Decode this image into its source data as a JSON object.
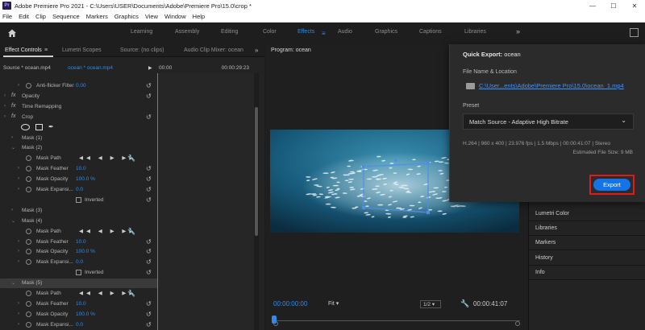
{
  "window": {
    "title": "Adobe Premiere Pro 2021 - C:\\Users\\USER\\Documents\\Adobe\\Premiere Pro\\15.0\\crop *",
    "app_badge": "Pr",
    "minimize": "—",
    "maximize": "☐",
    "close": "✕"
  },
  "menu": [
    "File",
    "Edit",
    "Clip",
    "Sequence",
    "Markers",
    "Graphics",
    "View",
    "Window",
    "Help"
  ],
  "workspaces": {
    "tabs": [
      "Learning",
      "Assembly",
      "Editing",
      "Color",
      "Effects",
      "Audio",
      "Graphics",
      "Captions",
      "Libraries"
    ],
    "active": "Effects",
    "more": "»"
  },
  "effect_controls": {
    "tabs": [
      "Effect Controls",
      "Lumetri Scopes",
      "Source: (no clips)",
      "Audio Clip Mixer: ocean"
    ],
    "panel_menu": "≡",
    "more": "»",
    "source_label": "Source * ocean.mp4",
    "clip_label": "ocean * ocean.mp4",
    "time_start": "00:00",
    "time_end": "00:00:29:23",
    "rows": [
      {
        "type": "prop",
        "label": "Anti-flicker Filter",
        "value": "0.00"
      },
      {
        "type": "fx",
        "label": "Opacity"
      },
      {
        "type": "fx",
        "label": "Time Remapping"
      },
      {
        "type": "fx",
        "label": "Crop"
      },
      {
        "type": "shapes"
      },
      {
        "type": "mask",
        "label": "Mask (1)"
      },
      {
        "type": "mask",
        "label": "Mask (2)"
      },
      {
        "type": "maskpath",
        "label": "Mask Path"
      },
      {
        "type": "prop",
        "label": "Mask Feather",
        "value": "10.0"
      },
      {
        "type": "prop",
        "label": "Mask Opacity",
        "value": "100.0 %"
      },
      {
        "type": "prop",
        "label": "Mask Expansi...",
        "value": "0.0"
      },
      {
        "type": "inverted",
        "label": "Inverted"
      },
      {
        "type": "mask",
        "label": "Mask (3)"
      },
      {
        "type": "mask",
        "label": "Mask (4)"
      },
      {
        "type": "maskpath",
        "label": "Mask Path"
      },
      {
        "type": "prop",
        "label": "Mask Feather",
        "value": "10.0"
      },
      {
        "type": "prop",
        "label": "Mask Opacity",
        "value": "100.0 %"
      },
      {
        "type": "prop",
        "label": "Mask Expansi...",
        "value": "0.0"
      },
      {
        "type": "inverted",
        "label": "Inverted"
      },
      {
        "type": "mask",
        "label": "Mask (5)",
        "highlight": true
      },
      {
        "type": "maskpath",
        "label": "Mask Path"
      },
      {
        "type": "prop",
        "label": "Mask Feather",
        "value": "10.0"
      },
      {
        "type": "prop",
        "label": "Mask Opacity",
        "value": "100.0 %"
      },
      {
        "type": "prop",
        "label": "Mask Expansi...",
        "value": "0.0"
      }
    ]
  },
  "program": {
    "tab": "Program: ocean",
    "more": "»",
    "timecode": "00:00:00:00",
    "fit": "Fit",
    "resolution": "1/2",
    "duration": "00:00:41:07"
  },
  "right_panels": [
    "Lumetri Color",
    "Libraries",
    "Markers",
    "History",
    "Info"
  ],
  "quick_export": {
    "title_prefix": "Quick Export:",
    "title_name": "ocean",
    "file_label": "File Name & Location",
    "path": "C:\\User...ents\\Adobe\\Premiere Pro\\15.0\\ocean_1.mp4",
    "preset_label": "Preset",
    "preset_value": "Match Source - Adaptive High Bitrate",
    "info": "H.264  |  960 x 400  |  23.976 fps  |  1.5 Mbps  |  00:00:41:07  |  Stereo",
    "file_size": "Estimated File Size: 9 MB",
    "export_label": "Export"
  }
}
